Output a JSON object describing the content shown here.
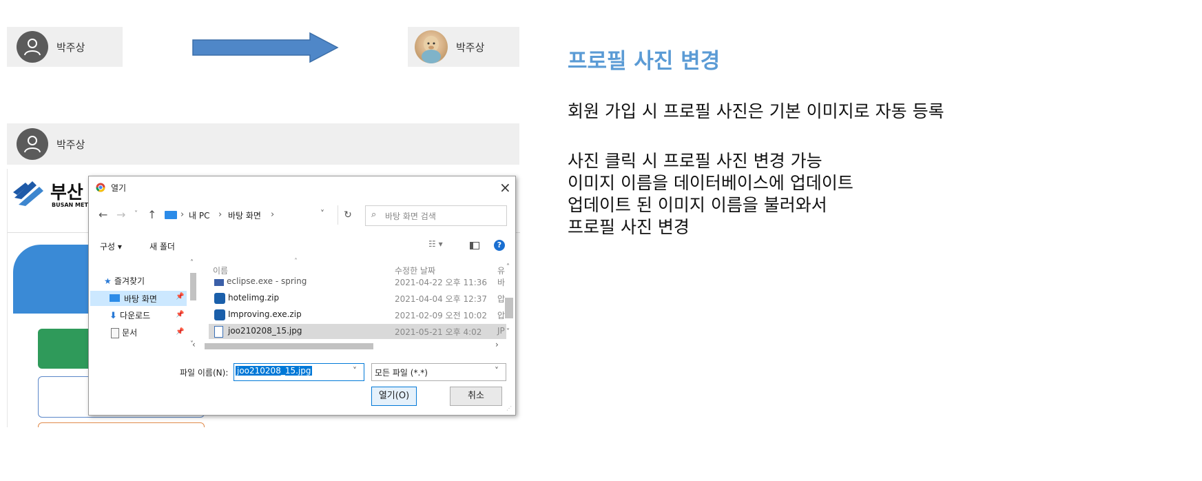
{
  "before_profile": {
    "name": "박주상"
  },
  "after_profile": {
    "name": "박주상"
  },
  "bottom_profile": {
    "name": "박주상"
  },
  "background_site": {
    "logo_text": "부산",
    "logo_sub": "BUSAN METR"
  },
  "dialog": {
    "title": "열기",
    "close_glyph": "×",
    "path_sep": "›",
    "path_items": [
      "내 PC",
      "바탕 화면"
    ],
    "search_placeholder": "바탕 화면 검색",
    "toolbar": {
      "organize": "구성 ▾",
      "new_folder": "새 폴더"
    },
    "nav_items": [
      {
        "label": "즐겨찾기",
        "icon": "star-icon"
      },
      {
        "label": "바탕 화면",
        "icon": "desktop-icon"
      },
      {
        "label": "다운로드",
        "icon": "download-icon"
      },
      {
        "label": "문서",
        "icon": "document-icon"
      }
    ],
    "columns": {
      "name": "이름",
      "date": "수정한 날짜",
      "type": "유"
    },
    "files": [
      {
        "name": "eclipse.exe - spring",
        "date": "2021-04-22 오후 11:36",
        "type": "바"
      },
      {
        "name": "hotelimg.zip",
        "date": "2021-04-04 오후 12:37",
        "type": "압"
      },
      {
        "name": "Improving.exe.zip",
        "date": "2021-02-09 오전 10:02",
        "type": "압"
      },
      {
        "name": "joo210208_15.jpg",
        "date": "2021-05-21 오후 4:02",
        "type": "JP"
      }
    ],
    "filename_label": "파일 이름(N):",
    "filename_value": "joo210208_15.jpg",
    "filter_value": "모든 파일 (*.*)",
    "open_button": "열기(O)",
    "cancel_button": "취소"
  },
  "right_panel": {
    "heading": "프로필 사진 변경",
    "lines": [
      "회원 가입 시 프로필 사진은 기본 이미지로 자동 등록",
      "사진 클릭 시 프로필 사진 변경 가능",
      "이미지 이름을 데이터베이스에 업데이트",
      "업데이트 된 이미지 이름을 불러와서",
      "프로필 사진 변경"
    ]
  },
  "colors": {
    "heading": "#5b9bd5",
    "arrow": "#4f87c8",
    "strip": "#efefef",
    "selection": "#0078d7"
  }
}
